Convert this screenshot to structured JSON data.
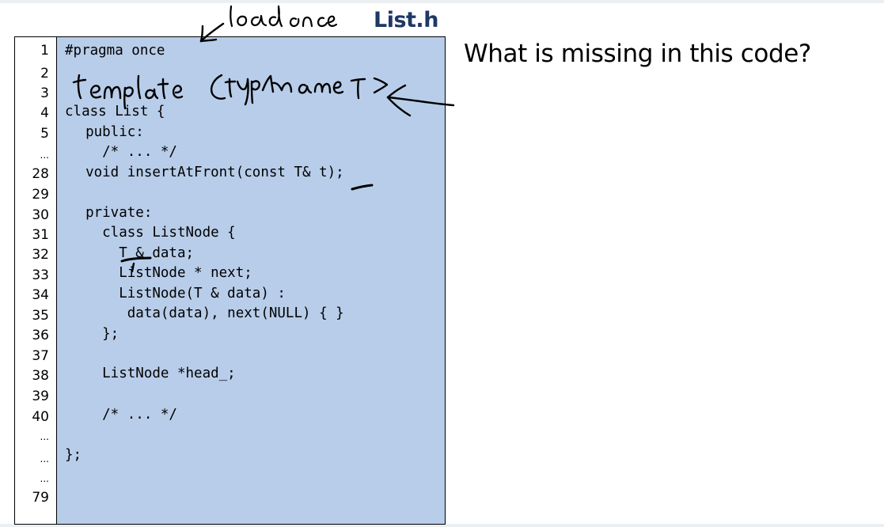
{
  "file_title": "List.h",
  "question": "What is missing in this code?",
  "line_numbers": [
    "1",
    "2",
    "3",
    "4",
    "5",
    "...",
    "28",
    "29",
    "30",
    "31",
    "32",
    "33",
    "34",
    "35",
    "36",
    "37",
    "38",
    "39",
    "40",
    "...",
    "...",
    "...",
    "79"
  ],
  "code_lines": [
    "#pragma once",
    "class List {",
    "  public:",
    "    /* ... */",
    "  void insertAtFront(const T& t);",
    "  private:",
    "    class ListNode {",
    "      T & data;",
    "      ListNode * next;",
    "      ListNode(T & data) :",
    "       data(data), next(NULL) { }",
    "    };",
    "    ListNode *head_;",
    "    /* ... */",
    "};"
  ],
  "handwritten": {
    "load_note": "load once",
    "template_note": "template <typename T>"
  },
  "colors": {
    "code_background": "#b8cde9",
    "title_color": "#1f3864"
  }
}
